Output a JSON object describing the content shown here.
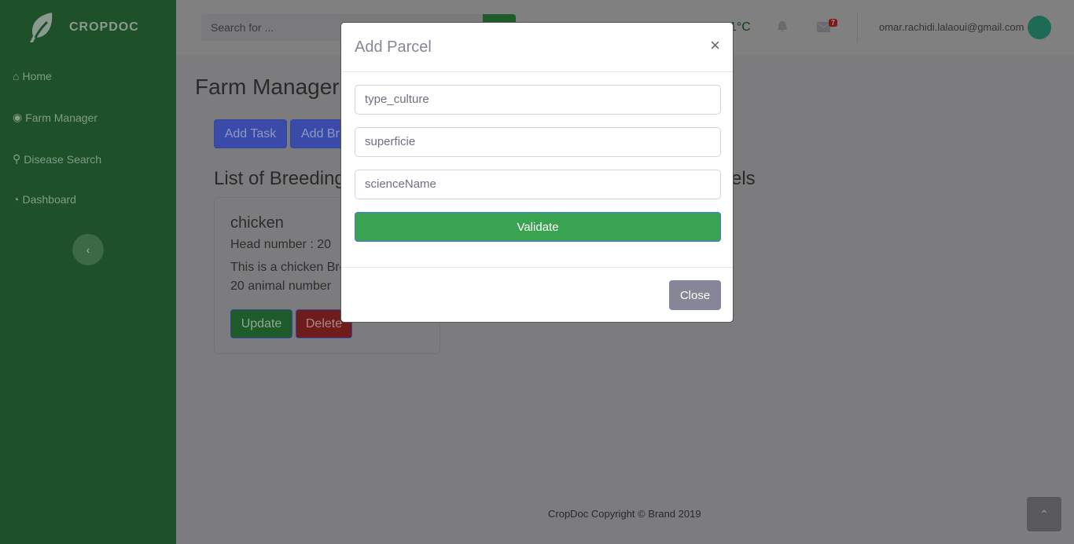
{
  "sidebar": {
    "brand": "CROPDOC",
    "items": [
      {
        "label": "Home",
        "icon": "home-icon"
      },
      {
        "label": "Farm Manager",
        "icon": "eye-icon"
      },
      {
        "label": "Disease Search",
        "icon": "search-icon"
      },
      {
        "label": "Dashboard",
        "icon": "tachometer-icon"
      }
    ],
    "toggle_icon": "chevron-left-icon"
  },
  "topbar": {
    "search_placeholder": "Search for ...",
    "temperature": "1°C",
    "messages_badge": "7",
    "user_email": "omar.rachidi.lalaoui@gmail.com"
  },
  "main": {
    "title": "Farm Manager",
    "buttons": [
      "Add Task",
      "Add Br"
    ],
    "section_left": "List of Breeding",
    "section_right": "els",
    "card": {
      "title": "chicken",
      "head_number": "Head number : 20",
      "description": "This is a chicken Bre",
      "animal_number": "20 animal number",
      "update": "Update",
      "delete": "Delete"
    }
  },
  "footer": "CropDoc Copyright © Brand 2019",
  "modal": {
    "title": "Add Parcel",
    "close_icon": "×",
    "fields": [
      "type_culture",
      "superficie",
      "scienceName"
    ],
    "validate": "Validate",
    "close": "Close"
  },
  "colors": {
    "sidebar": "#3aa252",
    "validate": "#3aa352",
    "close_button": "#858796"
  }
}
